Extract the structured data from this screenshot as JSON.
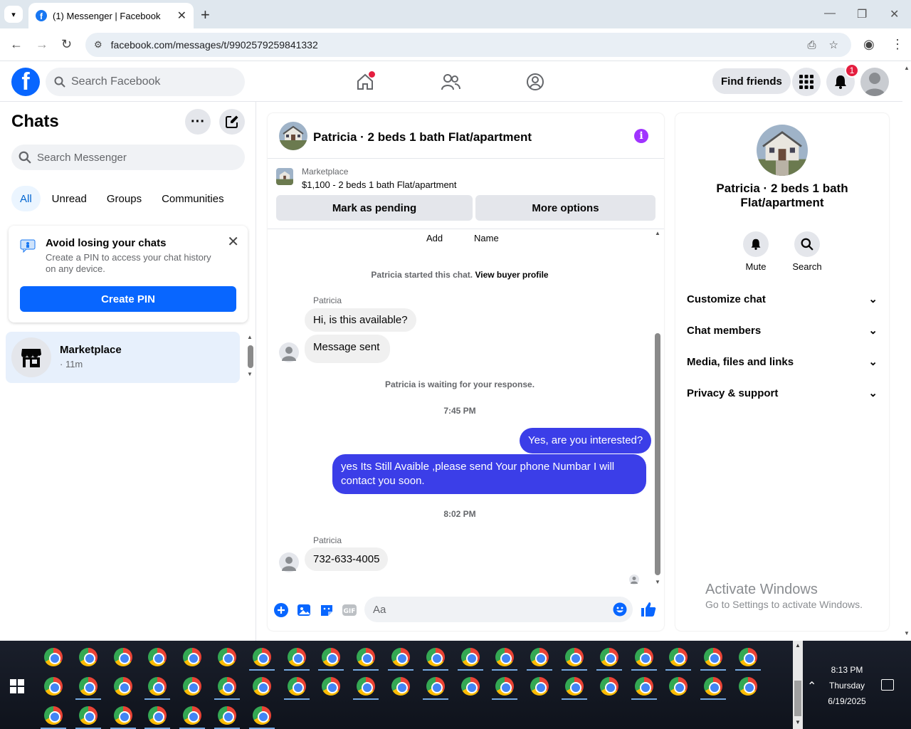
{
  "browser": {
    "tab_title": "(1) Messenger | Facebook",
    "url": "facebook.com/messages/t/9902579259841332"
  },
  "fbnav": {
    "search_placeholder": "Search Facebook",
    "find_friends": "Find friends",
    "notification_count": "1"
  },
  "left": {
    "title": "Chats",
    "search_placeholder": "Search Messenger",
    "filters": [
      "All",
      "Unread",
      "Groups",
      "Communities"
    ],
    "pin_card": {
      "title": "Avoid losing your chats",
      "subtitle": "Create a PIN to access your chat history on any device.",
      "button": "Create PIN"
    },
    "chat_item": {
      "name": "Marketplace",
      "time": "· 11m"
    }
  },
  "conversation": {
    "name": "Patricia · 2 beds 1 bath Flat/apartment",
    "marketplace_label": "Marketplace",
    "listing": "$1,100 - 2 beds 1 bath Flat/apartment",
    "mark_pending": "Mark as pending",
    "more_options": "More options",
    "top_cut": [
      "Add",
      "Name"
    ],
    "started_text": "Patricia started this chat.",
    "view_buyer": "View buyer profile",
    "sender1": "Patricia",
    "msg1": "Hi, is this available?",
    "msg2": "Message sent",
    "waiting": "Patricia is waiting for your response.",
    "time1": "7:45 PM",
    "out1": "Yes, are you interested?",
    "out2": "yes Its Still Avaible ,please send Your phone Numbar I will contact you soon.",
    "time2": "8:02 PM",
    "sender2": "Patricia",
    "msg3": "732-633-4005",
    "composer_placeholder": "Aa"
  },
  "right": {
    "name": "Patricia · 2 beds 1 bath Flat/apartment",
    "mute": "Mute",
    "search": "Search",
    "sections": [
      "Customize chat",
      "Chat members",
      "Media, files and links",
      "Privacy & support"
    ]
  },
  "watermark": {
    "line1": "Activate Windows",
    "line2": "Go to Settings to activate Windows."
  },
  "taskbar": {
    "time": "8:13 PM",
    "day": "Thursday",
    "date": "6/19/2025"
  },
  "colors": {
    "fb_blue": "#0866ff",
    "bubble_out": "#3b3ee8",
    "active_filter": "#0064d1"
  }
}
